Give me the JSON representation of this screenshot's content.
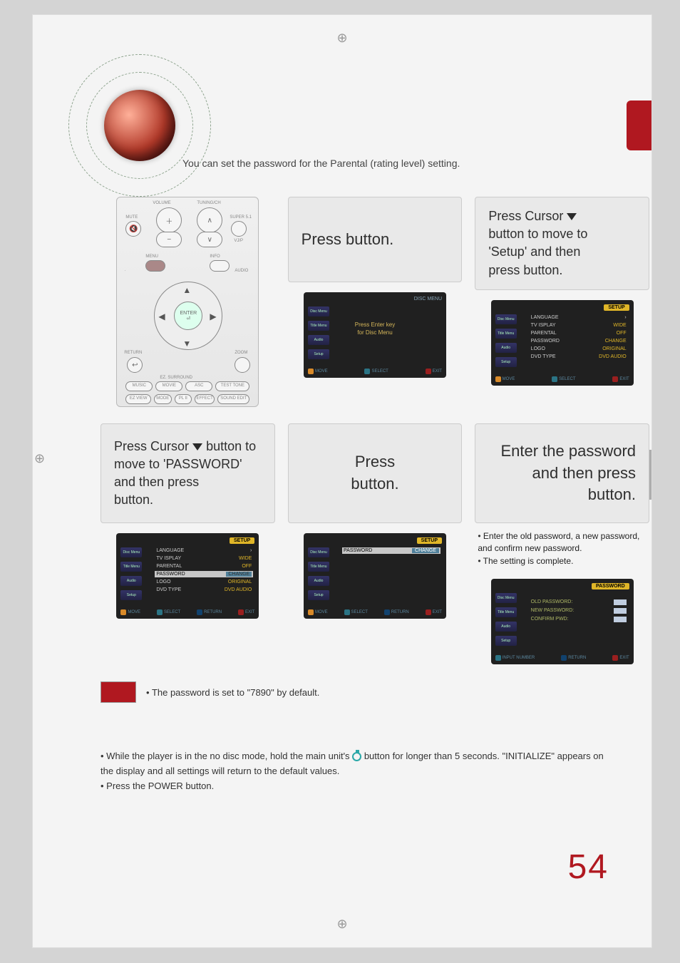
{
  "intro": "You can set the password for the Parental (rating level) setting.",
  "steps": {
    "s1": {
      "line": "Press          button."
    },
    "s2": {
      "l1": "Press Cursor",
      "l2": "button to move to",
      "l3": "'Setup' and then",
      "l4": "press          button."
    },
    "s3": {
      "l1": "Press Cursor",
      "l2": "button to",
      "l3": "move to 'PASSWORD'",
      "l4": "and then press",
      "l5": "button."
    },
    "s4": {
      "l1": "Press",
      "l2": "button."
    },
    "s5": {
      "l1": "Enter the password",
      "l2": "and then press",
      "l3": "button."
    }
  },
  "sub5": {
    "b1": "Enter the old password, a new password, and confirm new password.",
    "b2": "The setting is complete."
  },
  "screens": {
    "disc": {
      "title_right": "DISC MENU",
      "center1": "Press Enter key",
      "center2": "for Disc Menu"
    },
    "setup": {
      "title_right": "SETUP",
      "rows": [
        {
          "label": "LANGUAGE",
          "val": ""
        },
        {
          "label": "TV   ISPLAY",
          "val": "WIDE"
        },
        {
          "label": "PARENTAL",
          "val": "OFF"
        },
        {
          "label": "PASSWORD",
          "val": "CHANGE"
        },
        {
          "label": "LOGO",
          "val": "ORIGINAL"
        },
        {
          "label": "DVD TYPE",
          "val": "DVD AUDIO"
        }
      ]
    },
    "setup_pw": {
      "title_right": "SETUP",
      "row_label": "PASSWORD",
      "row_val": "CHANGE"
    },
    "password": {
      "title_right": "PASSWORD",
      "old": "OLD PASSWORD:",
      "new": "NEW PASSWORD:",
      "confirm": "CONFIRM PWD:"
    },
    "sidebar": [
      "Disc Menu",
      "Title Menu",
      "Audio",
      "Setup"
    ],
    "bottom": {
      "move": "MOVE",
      "select": "SELECT",
      "ret": "RETURN",
      "exit": "EXIT",
      "input": "INPUT NUMBER"
    }
  },
  "note": "The password is set to \"7890\" by default.",
  "forgot": {
    "line1a": "While the player is in the no disc mode, hold the main unit's",
    "line1b": "button for longer than 5 seconds. \"INITIALIZE\" appears on the display and all settings will return to the default values.",
    "line2": "Press the POWER button."
  },
  "page_number": "54",
  "remote": {
    "volume": "VOLUME",
    "tuning": "TUNING/CH",
    "mute": "MUTE",
    "super": "SUPER 5.1",
    "vjp": "VJ/P",
    "menu": "MENU",
    "info": "INFO",
    "enter": "ENTER",
    "return": "RETURN",
    "zoom": "ZOOM",
    "ez_surround": "EZ. SURROUND",
    "music": "MUSIC",
    "movie": "MOVIE",
    "asc": "ASC",
    "test": "TEST TONE",
    "ezview": "EZ VIEW",
    "plii": "PL II",
    "sound": "SOUND EDIT",
    "mode": "MODE",
    "effect": "EFFECT",
    "audio": "AUDIO",
    "sub": "·"
  }
}
